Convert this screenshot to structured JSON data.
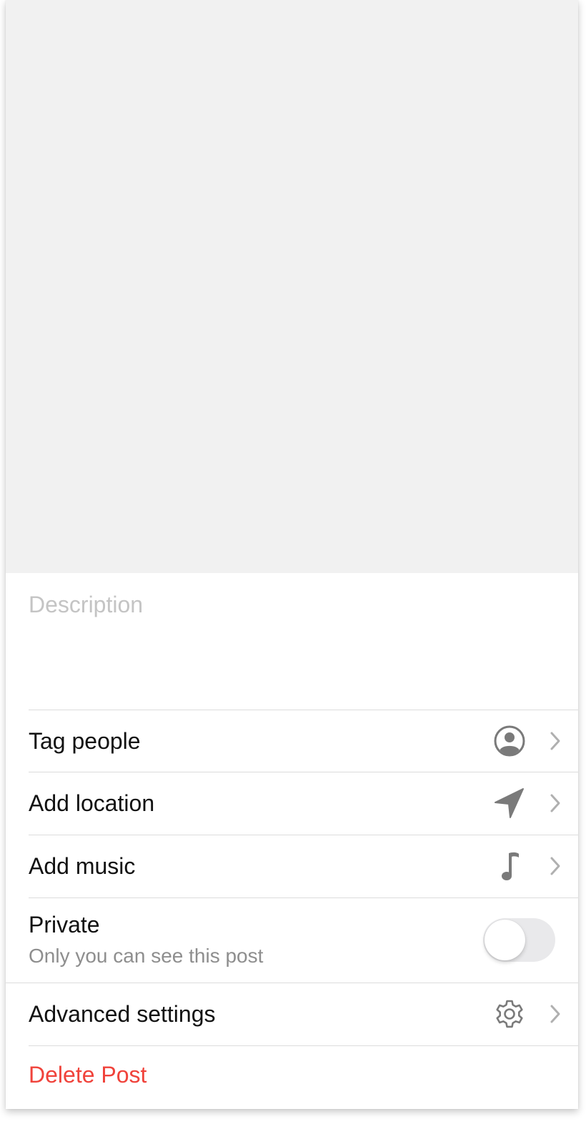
{
  "description": {
    "placeholder": "Description"
  },
  "options": {
    "tag_people": {
      "label": "Tag people",
      "icon": "person-circle-icon"
    },
    "add_location": {
      "label": "Add location",
      "icon": "location-arrow-icon"
    },
    "add_music": {
      "label": "Add music",
      "icon": "music-note-icon"
    },
    "advanced_settings": {
      "label": "Advanced settings",
      "icon": "gear-icon"
    }
  },
  "private": {
    "title": "Private",
    "subtitle": "Only you can see this post",
    "enabled": false
  },
  "delete": {
    "label": "Delete Post",
    "color": "#f0433b"
  },
  "colors": {
    "media_placeholder": "#f1f1f1",
    "icon": "#7a7a7a",
    "chevron": "#b0b0b0",
    "placeholder_text": "#c4c4c4"
  }
}
